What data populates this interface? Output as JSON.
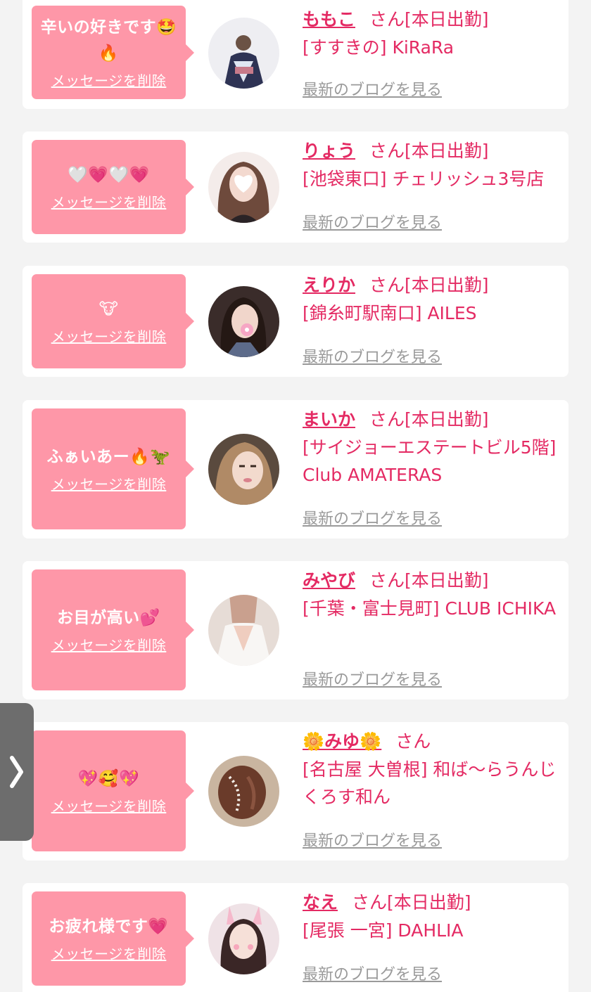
{
  "delete_label": "メッセージを削除",
  "blog_label": "最新のブログを見る",
  "suffix_label": "さん[本日出勤]",
  "colors": {
    "background": "#f3f3f3",
    "bubble": "#fe97a8",
    "accent": "#e42a63",
    "link_gray": "#9a9a9a",
    "side_tab": "#6d6d6d"
  },
  "side_tab": {
    "icon": "chevron-right-icon"
  },
  "entries": [
    {
      "message": "辛いの好きです🤩\n🔥",
      "name": "ももこ",
      "suffix": "さん[本日出勤]",
      "shop": "[すすきの] KiRaRa",
      "avatar": "woman-in-kimono-photo"
    },
    {
      "message": "🤍💗🤍💗",
      "name": "りょう",
      "suffix": "さん[本日出勤]",
      "shop": "[池袋東口] チェリッシュ3号店",
      "avatar": "woman-with-heart-sticker-photo"
    },
    {
      "message": "🐮",
      "name": "えりか",
      "suffix": "さん[本日出勤]",
      "shop": "[錦糸町駅南口] AILES",
      "avatar": "woman-with-flower-sticker-photo"
    },
    {
      "message": "ふぁいあー🔥🦖",
      "name": "まいか",
      "suffix": "さん[本日出勤]",
      "shop": "[サイジョーエステートビル5階] Club AMATERAS",
      "avatar": "woman-portrait-photo"
    },
    {
      "message": "お目が高い💕",
      "name": "みやび",
      "suffix": "さん[本日出勤]",
      "shop": "[千葉・富士見町] CLUB ICHIKA",
      "avatar": "woman-white-dress-photo"
    },
    {
      "message": "💖🥰💖",
      "name": "🌼みゆ🌼",
      "suffix": "さん",
      "shop": "[名古屋 大曽根] 和ば～らうんじくろす和ん",
      "avatar": "hair-updo-photo"
    },
    {
      "message": "お疲れ様です💗",
      "name": "なえ",
      "suffix": "さん[本日出勤]",
      "shop": "[尾張 一宮] DAHLIA",
      "avatar": "woman-with-bunny-filter-photo"
    }
  ]
}
